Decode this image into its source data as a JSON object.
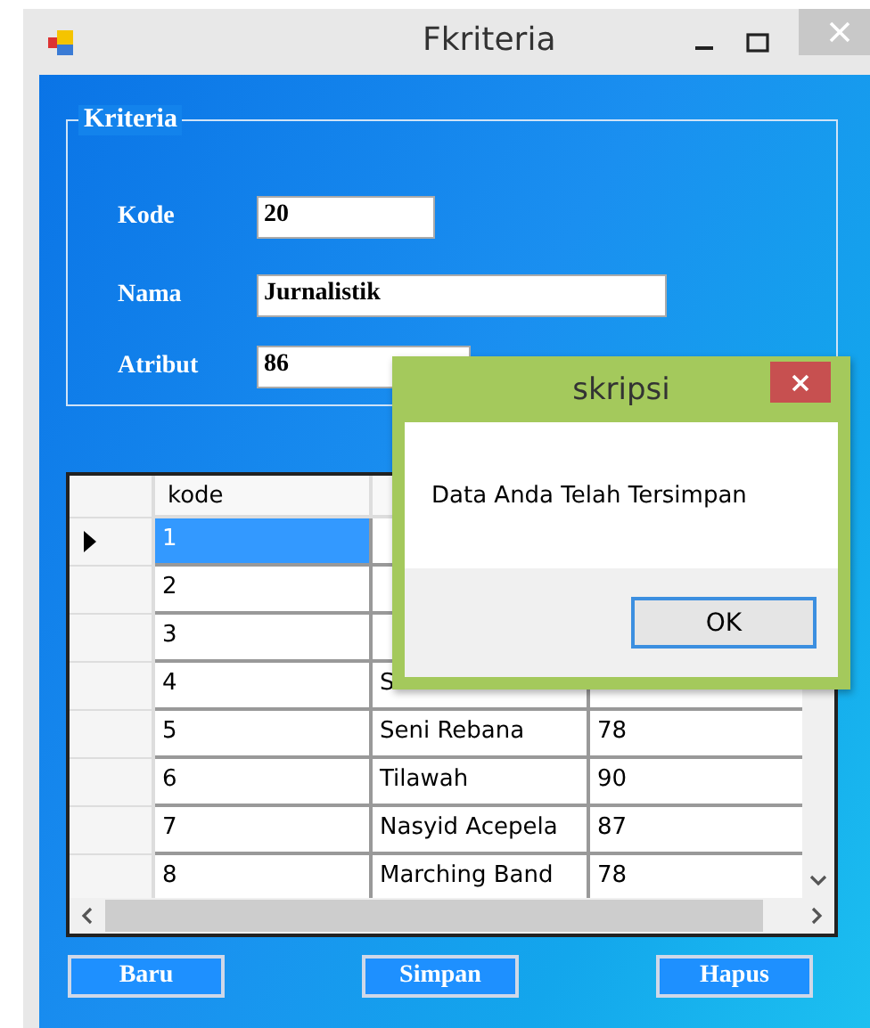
{
  "window": {
    "title": "Fkriteria"
  },
  "group": {
    "title": "Kriteria"
  },
  "fields": [
    {
      "label": "Kode",
      "value": "20"
    },
    {
      "label": "Nama",
      "value": "Jurnalistik"
    },
    {
      "label": "Atribut",
      "value": "86"
    }
  ],
  "table": {
    "columns": [
      "kode"
    ],
    "rows": [
      {
        "cells": [
          "1"
        ],
        "selected": true
      },
      {
        "cells": [
          "2"
        ],
        "selected": false
      },
      {
        "cells": [
          "3"
        ],
        "selected": false
      },
      {
        "cells": [
          "4",
          "S"
        ],
        "selected": false
      },
      {
        "cells": [
          "5",
          "Seni Rebana",
          "78"
        ],
        "selected": false
      },
      {
        "cells": [
          "6",
          "Tilawah",
          "90"
        ],
        "selected": false
      },
      {
        "cells": [
          "7",
          "Nasyid Acepela",
          "87"
        ],
        "selected": false
      },
      {
        "cells": [
          "8",
          "Marching Band",
          "78"
        ],
        "selected": false
      }
    ]
  },
  "buttons": [
    "Baru",
    "Simpan",
    "Hapus"
  ],
  "dialog": {
    "title": "skripsi",
    "message": "Data Anda Telah Tersimpan",
    "button": "OK"
  }
}
